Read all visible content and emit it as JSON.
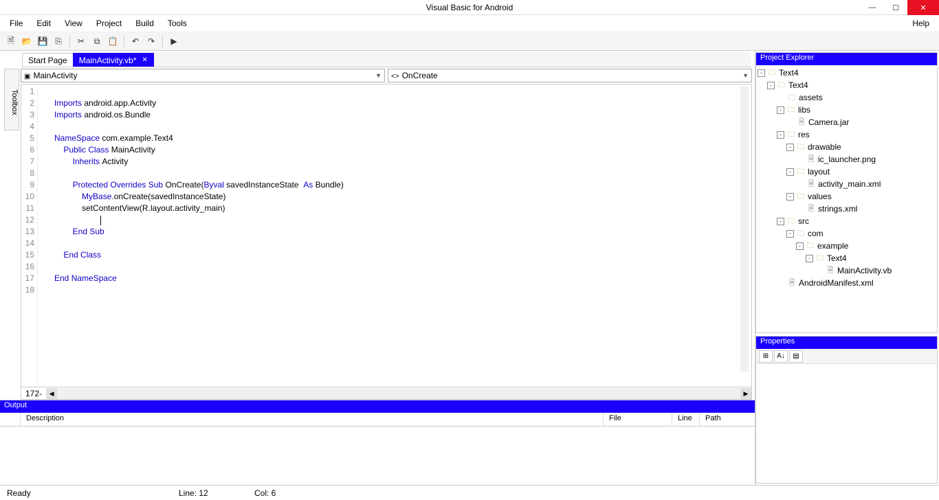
{
  "title": "Visual Basic for Android",
  "menubar": {
    "items": [
      "File",
      "Edit",
      "View",
      "Project",
      "Build",
      "Tools"
    ],
    "help": "Help"
  },
  "tabs": {
    "start": "Start Page",
    "active": "MainActivity.vb*"
  },
  "toolbox_label": "Toolbox",
  "dropdowns": {
    "class_label": "MainActivity",
    "method_label": "OnCreate"
  },
  "code": {
    "lines": [
      {
        "n": 1,
        "ind": 0,
        "tokens": []
      },
      {
        "n": 2,
        "ind": 0,
        "tokens": [
          {
            "t": "Imports",
            "kw": true
          },
          {
            "t": " android.app.Activity"
          }
        ]
      },
      {
        "n": 3,
        "ind": 0,
        "tokens": [
          {
            "t": "Imports",
            "kw": true
          },
          {
            "t": " android.os.Bundle"
          }
        ]
      },
      {
        "n": 4,
        "ind": 0,
        "tokens": []
      },
      {
        "n": 5,
        "ind": 0,
        "tokens": [
          {
            "t": "NameSpace",
            "kw": true
          },
          {
            "t": " com.example.Text4"
          }
        ]
      },
      {
        "n": 6,
        "ind": 1,
        "tokens": [
          {
            "t": "Public",
            "kw": true
          },
          {
            "t": " "
          },
          {
            "t": "Class",
            "kw": true
          },
          {
            "t": " MainActivity"
          }
        ]
      },
      {
        "n": 7,
        "ind": 2,
        "tokens": [
          {
            "t": "Inherits",
            "kw": true
          },
          {
            "t": " Activity"
          }
        ]
      },
      {
        "n": 8,
        "ind": 0,
        "tokens": []
      },
      {
        "n": 9,
        "ind": 2,
        "tokens": [
          {
            "t": "Protected",
            "kw": true
          },
          {
            "t": " "
          },
          {
            "t": "Overrides",
            "kw": true
          },
          {
            "t": " "
          },
          {
            "t": "Sub",
            "kw": true
          },
          {
            "t": " OnCreate("
          },
          {
            "t": "Byval",
            "kw": true
          },
          {
            "t": " savedInstanceState  "
          },
          {
            "t": "As",
            "kw": true
          },
          {
            "t": " Bundle)"
          }
        ]
      },
      {
        "n": 10,
        "ind": 3,
        "tokens": [
          {
            "t": "MyBase",
            "kw": true
          },
          {
            "t": ".onCreate(savedInstanceState)"
          }
        ]
      },
      {
        "n": 11,
        "ind": 3,
        "tokens": [
          {
            "t": "setContentView(R.layout.activity_main)"
          }
        ]
      },
      {
        "n": 12,
        "ind": 5,
        "tokens": [],
        "cursor": true
      },
      {
        "n": 13,
        "ind": 2,
        "tokens": [
          {
            "t": "End",
            "kw": true
          },
          {
            "t": " "
          },
          {
            "t": "Sub",
            "kw": true
          }
        ]
      },
      {
        "n": 14,
        "ind": 0,
        "tokens": []
      },
      {
        "n": 15,
        "ind": 1,
        "tokens": [
          {
            "t": "End",
            "kw": true
          },
          {
            "t": " "
          },
          {
            "t": "Class",
            "kw": true
          }
        ]
      },
      {
        "n": 16,
        "ind": 0,
        "tokens": []
      },
      {
        "n": 17,
        "ind": 0,
        "tokens": [
          {
            "t": "End",
            "kw": true
          },
          {
            "t": " "
          },
          {
            "t": "NameSpace",
            "kw": true
          }
        ]
      },
      {
        "n": 18,
        "ind": 0,
        "tokens": []
      }
    ],
    "zoom": "172-"
  },
  "panels": {
    "project_explorer": "Project Explorer",
    "properties": "Properties",
    "output": "Output"
  },
  "output_columns": {
    "description": "Description",
    "file": "File",
    "line": "Line",
    "path": "Path"
  },
  "tree": [
    {
      "depth": 0,
      "toggle": "-",
      "icon": "folder",
      "label": "Text4"
    },
    {
      "depth": 1,
      "toggle": "-",
      "icon": "folder",
      "label": "Text4"
    },
    {
      "depth": 2,
      "toggle": "",
      "icon": "folder",
      "label": "assets"
    },
    {
      "depth": 2,
      "toggle": "-",
      "icon": "folder",
      "label": "libs"
    },
    {
      "depth": 3,
      "toggle": "",
      "icon": "file",
      "label": "Camera.jar"
    },
    {
      "depth": 2,
      "toggle": "-",
      "icon": "folder",
      "label": "res"
    },
    {
      "depth": 3,
      "toggle": "-",
      "icon": "folder",
      "label": "drawable"
    },
    {
      "depth": 4,
      "toggle": "",
      "icon": "file",
      "label": "ic_launcher.png"
    },
    {
      "depth": 3,
      "toggle": "-",
      "icon": "folder",
      "label": "layout"
    },
    {
      "depth": 4,
      "toggle": "",
      "icon": "file",
      "label": "activity_main.xml"
    },
    {
      "depth": 3,
      "toggle": "-",
      "icon": "folder",
      "label": "values"
    },
    {
      "depth": 4,
      "toggle": "",
      "icon": "file",
      "label": "strings.xml"
    },
    {
      "depth": 2,
      "toggle": "-",
      "icon": "folder",
      "label": "src"
    },
    {
      "depth": 3,
      "toggle": "-",
      "icon": "folder",
      "label": "com"
    },
    {
      "depth": 4,
      "toggle": "-",
      "icon": "folder",
      "label": "example"
    },
    {
      "depth": 5,
      "toggle": "-",
      "icon": "folder",
      "label": "Text4"
    },
    {
      "depth": 6,
      "toggle": "",
      "icon": "file",
      "label": "MainActivity.vb"
    },
    {
      "depth": 2,
      "toggle": "",
      "icon": "file",
      "label": "AndroidManifest.xml"
    }
  ],
  "status": {
    "ready": "Ready",
    "line": "Line: 12",
    "col": "Col: 6"
  }
}
